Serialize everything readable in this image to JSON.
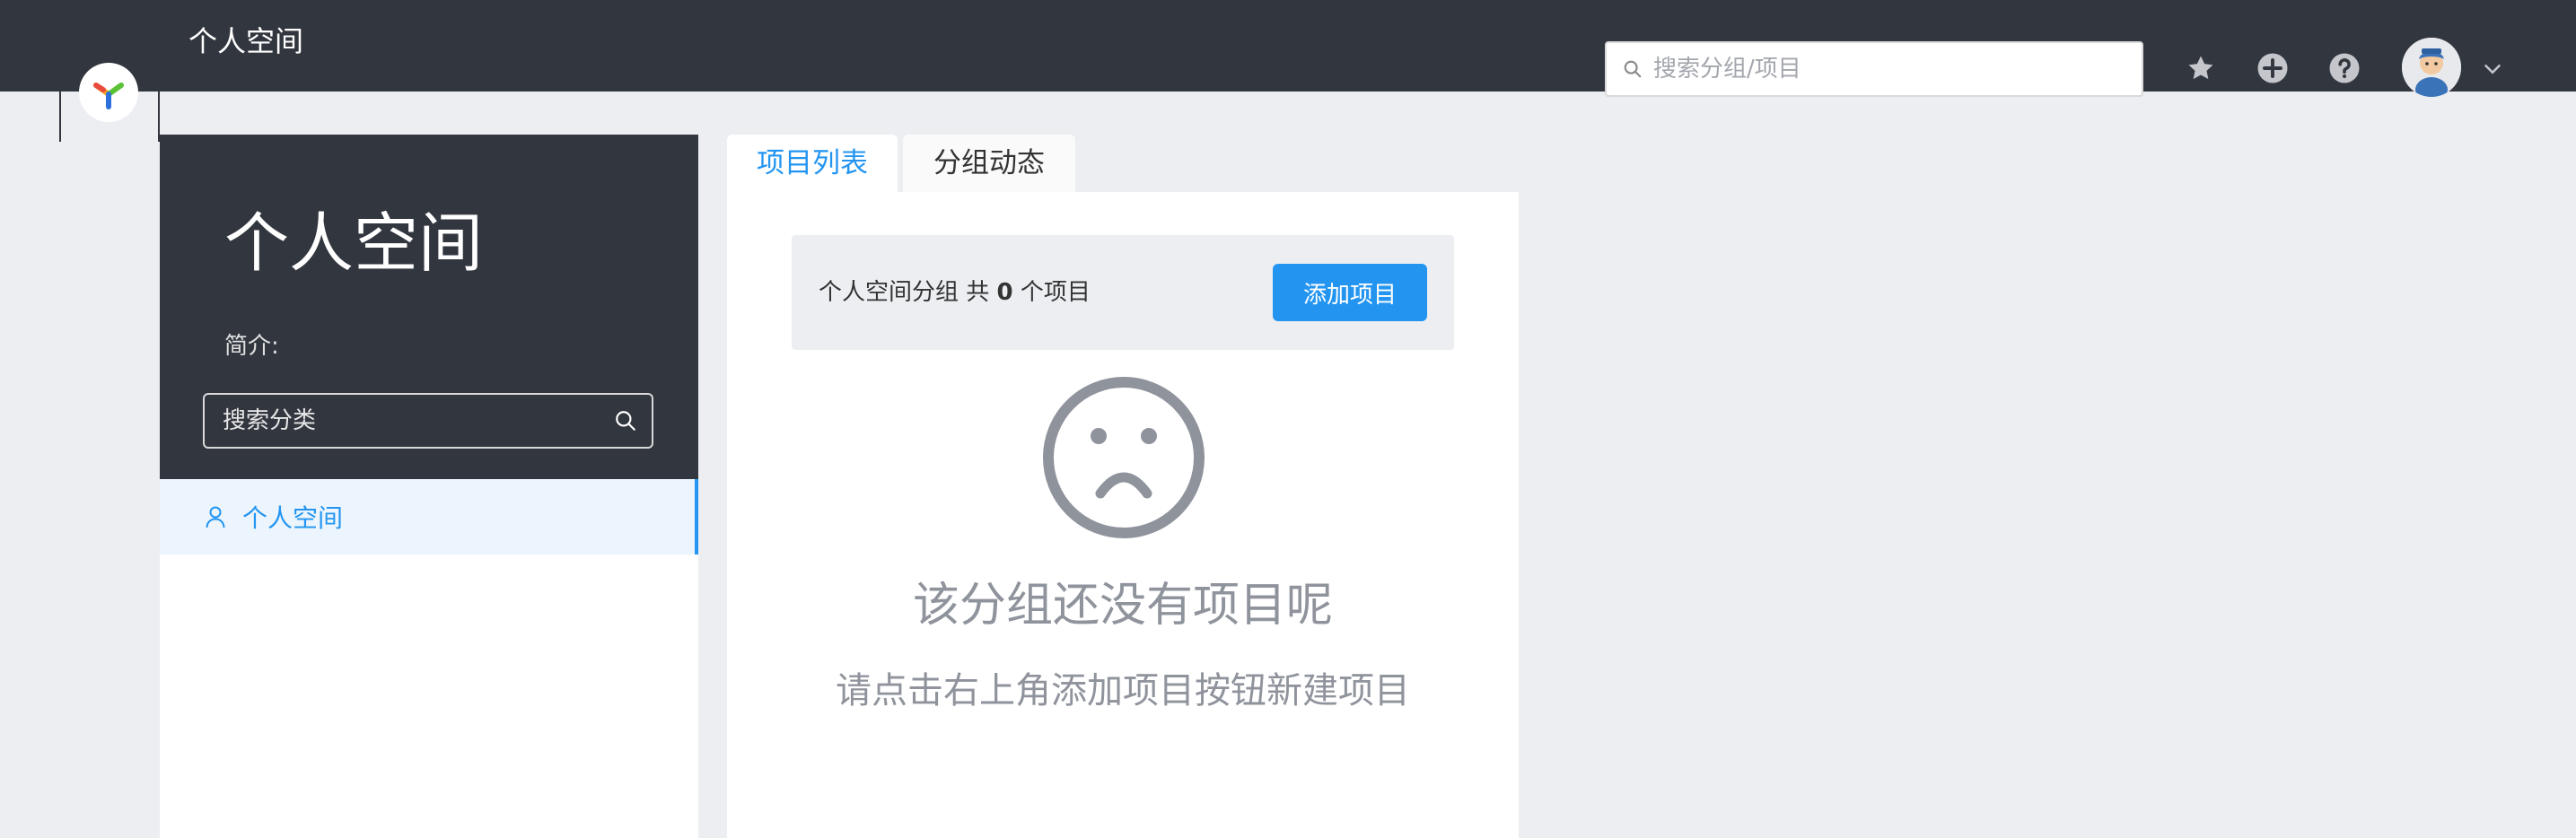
{
  "header": {
    "title": "个人空间",
    "search_placeholder": "搜索分组/项目",
    "icons": [
      "star-icon",
      "plus-circle-icon",
      "question-icon"
    ],
    "avatar": "user-avatar"
  },
  "sidebar": {
    "group_title": "个人空间",
    "description_label": "简介:",
    "category_search_placeholder": "搜索分类",
    "groups": [
      {
        "label": "个人空间",
        "icon": "user-icon",
        "active": true
      }
    ]
  },
  "tabs": [
    {
      "label": "项目列表",
      "active": true
    },
    {
      "label": "分组动态",
      "active": false
    }
  ],
  "main": {
    "summary_prefix": "个人空间分组 共",
    "project_count": "0",
    "summary_suffix": "个项目",
    "add_button": "添加项目",
    "empty_icon": "sad-face-icon",
    "empty_title": "该分组还没有项目呢",
    "empty_desc": "请点击右上角添加项目按钮新建项目"
  },
  "colors": {
    "header_bg": "#32363f",
    "accent": "#2395f1",
    "page_bg": "#eceef2",
    "empty_text": "#8f939c"
  }
}
